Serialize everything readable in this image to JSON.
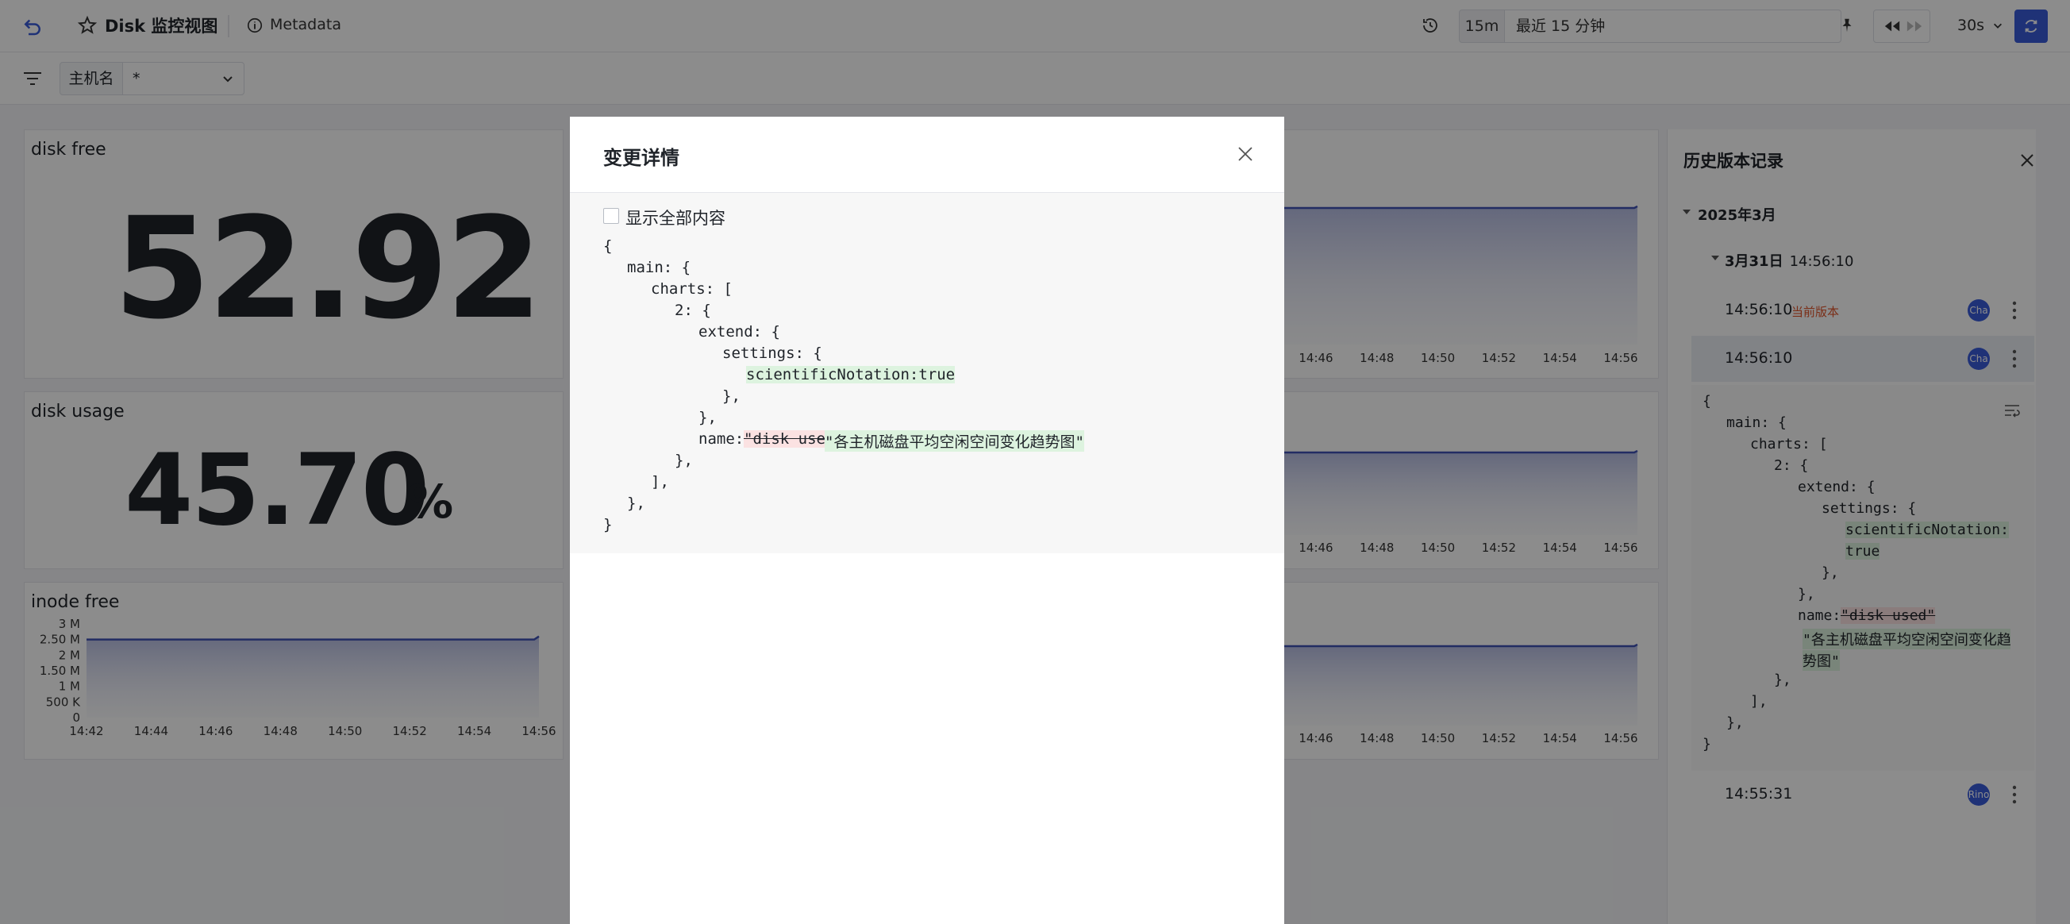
{
  "header": {
    "title": "Disk 监控视图",
    "metadata_label": "Metadata",
    "range_short": "15m",
    "range_text": "最近 15 分钟",
    "refresh_interval": "30s"
  },
  "filter": {
    "host_label": "主机名",
    "host_value": "*"
  },
  "panels": {
    "disk_free": {
      "title": "disk free",
      "value": "52.92"
    },
    "disk_usage": {
      "title": "disk usage",
      "value": "45.70",
      "unit": "%"
    },
    "inode_free": {
      "title": "inode free"
    }
  },
  "chart_data": [
    {
      "type": "area",
      "title": "inode free",
      "y_ticks": [
        "3 M",
        "2.50 M",
        "2 M",
        "1.50 M",
        "1 M",
        "500 K",
        "0"
      ],
      "x_ticks": [
        "14:42",
        "14:44",
        "14:46",
        "14:48",
        "14:50",
        "14:52",
        "14:54",
        "14:56"
      ],
      "ylim": [
        0,
        3000000
      ],
      "series": [
        {
          "x": [
            "14:42",
            "14:56"
          ],
          "values": [
            2500000,
            2500000
          ]
        }
      ]
    },
    {
      "type": "area",
      "x_ticks": [
        "14:46",
        "14:48",
        "14:50",
        "14:52",
        "14:54",
        "14:56"
      ]
    },
    {
      "type": "area",
      "x_ticks": [
        "14:46",
        "14:48",
        "14:50",
        "14:52",
        "14:54",
        "14:56"
      ]
    },
    {
      "type": "area",
      "x_ticks": [
        "14:46",
        "14:48",
        "14:50",
        "14:52",
        "14:54",
        "14:56"
      ]
    }
  ],
  "history": {
    "title": "历史版本记录",
    "group": "2025年3月",
    "day": {
      "date": "3月31日",
      "time": "14:56:10"
    },
    "entries": [
      {
        "time": "14:56:10",
        "tag": "当前版本",
        "avatar": "Cha"
      },
      {
        "time": "14:56:10",
        "avatar": "Cha"
      },
      {
        "time": "14:55:31",
        "avatar": "Rino"
      }
    ],
    "diff": {
      "l1": "{",
      "l2": "main: {",
      "l3": "charts: [",
      "l4": "2: {",
      "l5": "extend: {",
      "l6": "settings: {",
      "l7a": "scientificNotation:",
      "l7b": "true",
      "l8": "},",
      "l9": "},",
      "l10_key": "name:",
      "l10_del": "\"disk used\"",
      "l11a": "\"各主机磁盘平均空闲空间变化趋",
      "l11b": "势图\"",
      "l12": "},",
      "l13": "],",
      "l14": "},",
      "l15": "}"
    }
  },
  "modal": {
    "title": "变更详情",
    "show_all_label": "显示全部内容",
    "code": {
      "l1": "{",
      "l2": "main: {",
      "l3": "charts: [",
      "l4": "2: {",
      "l5": "extend: {",
      "l6": "settings: {",
      "l7": "scientificNotation:true",
      "l8": "},",
      "l9": "},",
      "l10_key": "name:",
      "l10_del": "\"disk used\"",
      "l10_add": "\"各主机磁盘平均空闲空间变化趋势图\"",
      "l11": "},",
      "l12": "],",
      "l13": "},",
      "l14": "}"
    }
  }
}
